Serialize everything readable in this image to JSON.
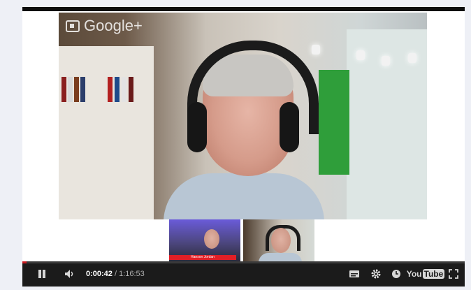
{
  "video": {
    "brand_label": "Google+",
    "participants": [
      {
        "name_tag": "Hanson Jordan"
      },
      {
        "name_tag": ""
      }
    ]
  },
  "controls": {
    "current_time": "0:00:42",
    "separator": " / ",
    "duration": "1:16:53",
    "progress_fraction": 0.009,
    "youtube_you": "You",
    "youtube_tube": "Tube"
  },
  "colors": {
    "progress": "#cc181e",
    "controls_bg": "#1b1b1b"
  }
}
